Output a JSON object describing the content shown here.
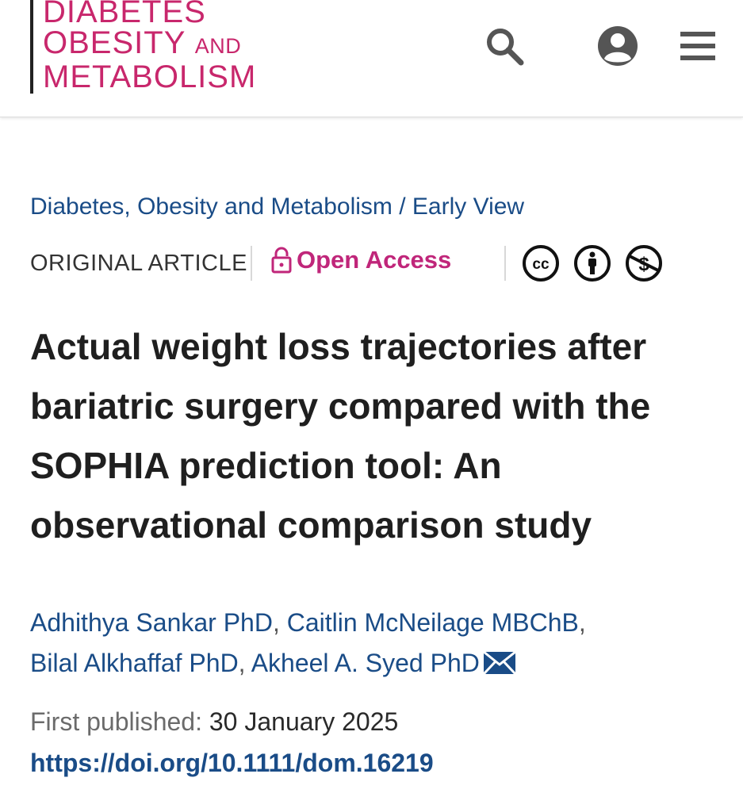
{
  "header": {
    "logo": {
      "line1": "DIABETES",
      "line2_main": "OBESITY",
      "line2_small": "AND",
      "line3": "METABOLISM"
    },
    "icons": [
      "search-icon",
      "account-icon",
      "menu-icon"
    ]
  },
  "breadcrumb": {
    "journal": "Diabetes, Obesity and Metabolism",
    "separator": "/",
    "section": "Early View"
  },
  "article_meta": {
    "type": "ORIGINAL ARTICLE",
    "access": "Open Access",
    "licenses": [
      "cc-icon",
      "attribution-icon",
      "noncommercial-icon"
    ]
  },
  "article": {
    "title": "Actual weight loss trajectories after bariatric surgery compared with the SOPHIA prediction tool: An observational comparison study"
  },
  "authors": [
    {
      "name": "Adhithya Sankar PhD"
    },
    {
      "name": "Caitlin McNeilage MBChB"
    },
    {
      "name": "Bilal Alkhaffaf PhD"
    },
    {
      "name": "Akheel A. Syed PhD"
    }
  ],
  "publication": {
    "first_published_label": "First published:",
    "first_published_date": "30 January 2025",
    "doi": "https://doi.org/10.1111/dom.16219"
  },
  "colors": {
    "brand_magenta": "#c8276c",
    "link_blue": "#1a4c87",
    "open_access": "#c0267a"
  }
}
